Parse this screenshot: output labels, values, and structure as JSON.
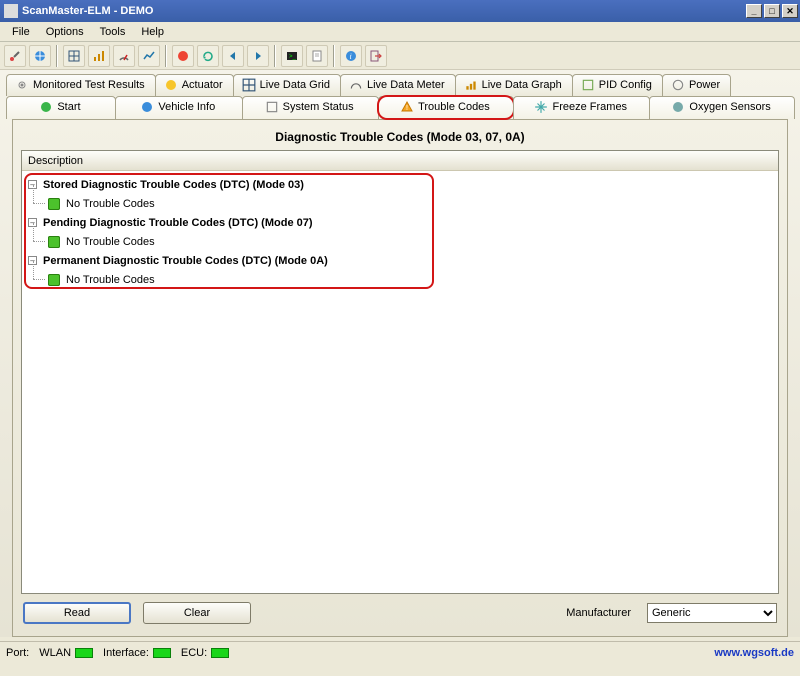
{
  "window": {
    "title": "ScanMaster-ELM - DEMO"
  },
  "menu": [
    "File",
    "Options",
    "Tools",
    "Help"
  ],
  "tabsTop": [
    {
      "label": "Monitored Test Results"
    },
    {
      "label": "Actuator"
    },
    {
      "label": "Live Data Grid"
    },
    {
      "label": "Live Data Meter"
    },
    {
      "label": "Live Data Graph"
    },
    {
      "label": "PID Config"
    },
    {
      "label": "Power"
    }
  ],
  "tabsBottom": [
    {
      "label": "Start"
    },
    {
      "label": "Vehicle Info"
    },
    {
      "label": "System Status"
    },
    {
      "label": "Trouble Codes"
    },
    {
      "label": "Freeze Frames"
    },
    {
      "label": "Oxygen Sensors"
    }
  ],
  "sectionTitle": "Diagnostic Trouble Codes (Mode 03, 07, 0A)",
  "column": "Description",
  "tree": [
    {
      "label": "Stored Diagnostic Trouble Codes (DTC) (Mode 03)",
      "child": "No Trouble Codes"
    },
    {
      "label": "Pending Diagnostic Trouble Codes (DTC) (Mode 07)",
      "child": "No Trouble Codes"
    },
    {
      "label": "Permanent Diagnostic Trouble Codes (DTC) (Mode 0A)",
      "child": "No Trouble Codes"
    }
  ],
  "buttons": {
    "read": "Read",
    "clear": "Clear"
  },
  "manufacturer": {
    "label": "Manufacturer",
    "value": "Generic"
  },
  "status": {
    "port": "Port:",
    "wlan": "WLAN",
    "iface": "Interface:",
    "ecu": "ECU:",
    "url": "www.wgsoft.de"
  }
}
